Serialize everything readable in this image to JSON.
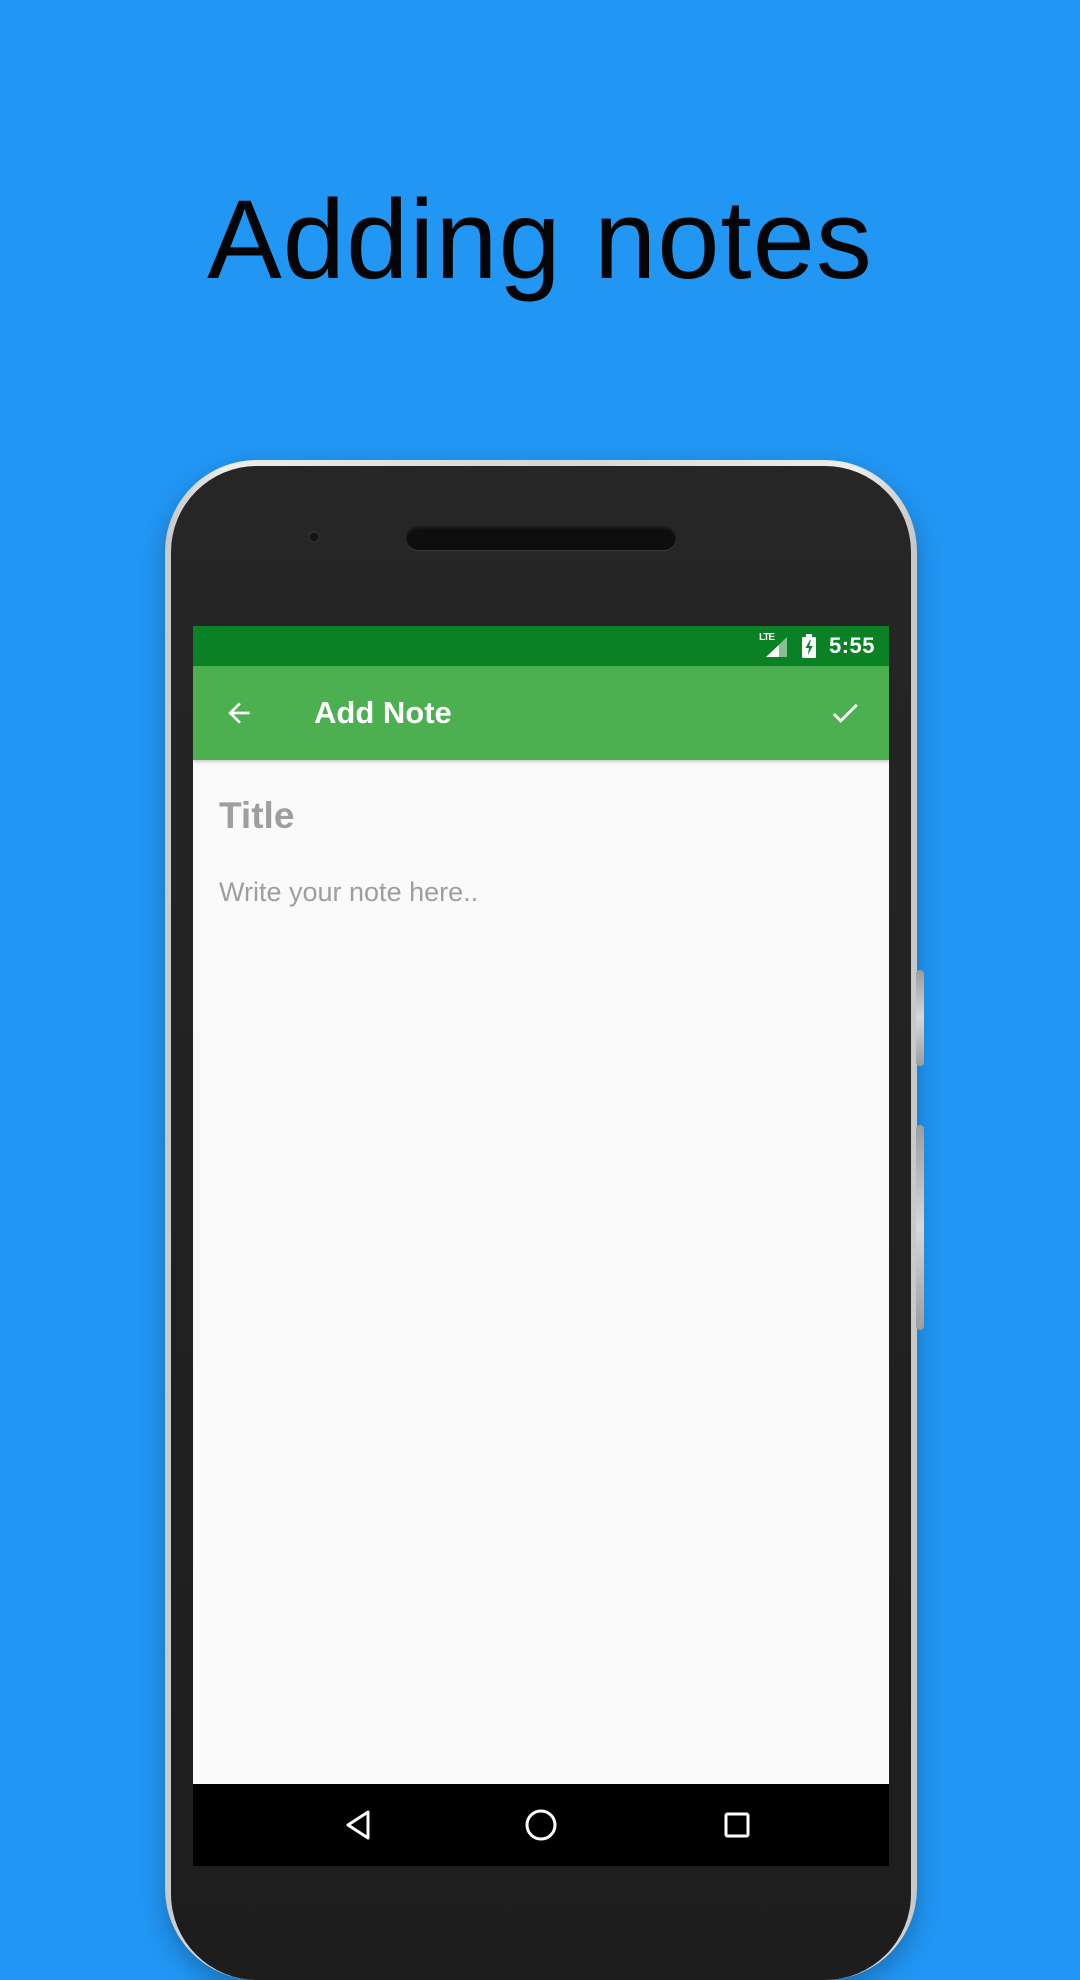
{
  "promo": {
    "headline": "Adding notes"
  },
  "status_bar": {
    "network": "LTE",
    "time": "5:55"
  },
  "toolbar": {
    "title": "Add Note",
    "back_icon": "arrow-left-icon",
    "done_icon": "checkmark-icon"
  },
  "editor": {
    "title_placeholder": "Title",
    "body_placeholder": "Write your note here.."
  },
  "navigation": {
    "back_icon": "triangle-back-icon",
    "home_icon": "circle-home-icon",
    "recents_icon": "square-recents-icon"
  },
  "colors": {
    "background": "#2196F3",
    "status_bar": "#0A8125",
    "toolbar": "#4CAF50",
    "content": "#FAFAFA",
    "placeholder": "#9E9E9E",
    "nav_bar": "#000000"
  }
}
